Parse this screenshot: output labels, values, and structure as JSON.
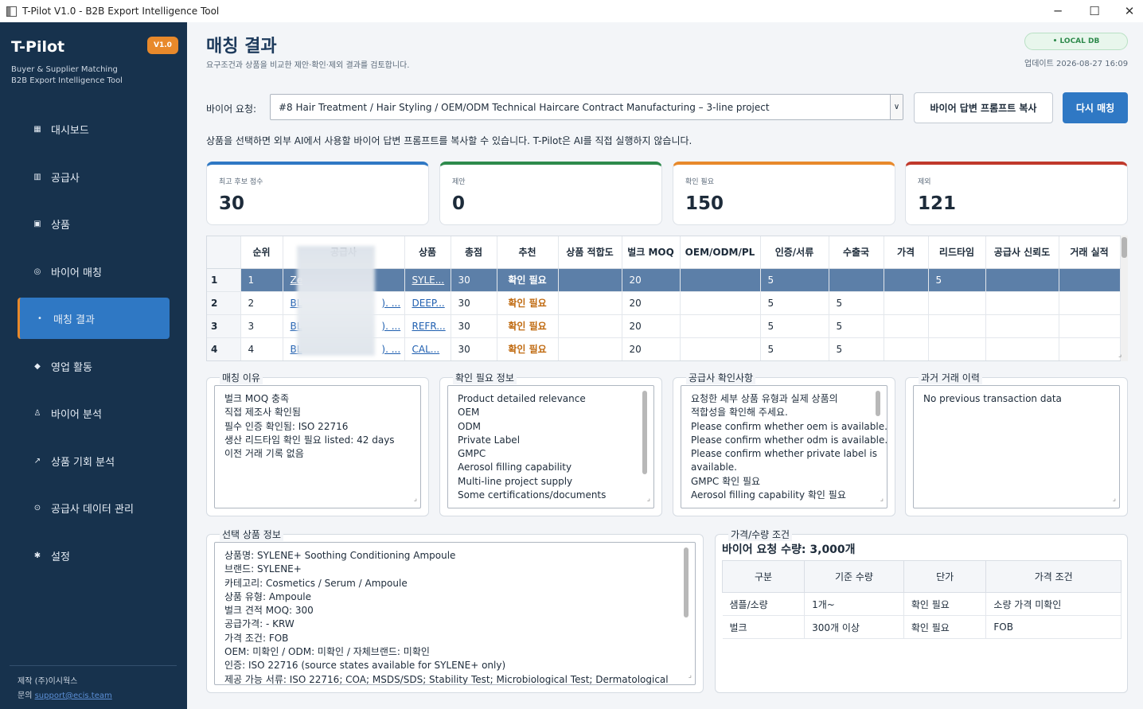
{
  "window": {
    "title": "T-Pilot V1.0 - B2B Export Intelligence Tool"
  },
  "sidebar": {
    "brand": "T-Pilot",
    "version": "V1.0",
    "subtitle1": "Buyer & Supplier Matching",
    "subtitle2": "B2B Export Intelligence Tool",
    "items": [
      {
        "label": "대시보드",
        "icon": "dashboard-icon",
        "glyph": "▦"
      },
      {
        "label": "공급사",
        "icon": "supplier-icon",
        "glyph": "▥"
      },
      {
        "label": "상품",
        "icon": "product-icon",
        "glyph": "▣"
      },
      {
        "label": "바이어 매칭",
        "icon": "target-icon",
        "glyph": "◎"
      },
      {
        "label": "매칭 결과",
        "icon": "dot-icon",
        "glyph": "•"
      },
      {
        "label": "영업 활동",
        "icon": "diamond-icon",
        "glyph": "◆"
      },
      {
        "label": "바이어 분석",
        "icon": "person-icon",
        "glyph": "♙"
      },
      {
        "label": "상품 기회 분석",
        "icon": "trend-icon",
        "glyph": "↗"
      },
      {
        "label": "공급사 데이터 관리",
        "icon": "data-icon",
        "glyph": "⊙"
      },
      {
        "label": "설정",
        "icon": "gear-icon",
        "glyph": "✱"
      }
    ],
    "credit_maker": "제작 (주)이시웍스",
    "credit_contact_label": "문의",
    "credit_contact_link": "support@ecis.team"
  },
  "header": {
    "title": "매칭 결과",
    "subtitle": "요구조건과 상품을 비교한 제안·확인·제외 결과를 검토합니다.",
    "db_badge": "• LOCAL DB",
    "updated": "업데이트  2026-08-27 16:09"
  },
  "buyer": {
    "label": "바이어 요청:",
    "selected": "#8 Hair Treatment / Hair Styling / OEM/ODM Technical Haircare Contract Manufacturing – 3-line project",
    "copy_button": "바이어 답변 프롬프트 복사",
    "rematch_button": "다시 매칭",
    "notice": "상품을 선택하면 외부 AI에서 사용할 바이어 답변 프롬프트를 복사할 수 있습니다. T-Pilot은 AI를 직접 실행하지 않습니다."
  },
  "cards": [
    {
      "label": "최고 후보 점수",
      "value": "30",
      "color": "#2f78c4"
    },
    {
      "label": "제안",
      "value": "0",
      "color": "#2e8a4c"
    },
    {
      "label": "확인 필요",
      "value": "150",
      "color": "#e8892b"
    },
    {
      "label": "제외",
      "value": "121",
      "color": "#c0392b"
    }
  ],
  "table": {
    "columns": [
      "",
      "순위",
      "공급사",
      "상품",
      "총점",
      "추천",
      "상품 적합도",
      "벌크 MOQ",
      "OEM/ODM/PL",
      "인증/서류",
      "수출국",
      "가격",
      "리드타임",
      "공급사 신뢰도",
      "거래 실적"
    ],
    "rows": [
      [
        "1",
        "1",
        "Ze",
        "SYLE...",
        "30",
        "확인 필요",
        "",
        "20",
        "",
        "5",
        "",
        "",
        "5",
        "",
        ""
      ],
      [
        "2",
        "2",
        "BL",
        "DEEP...",
        "30",
        "확인 필요",
        "",
        "20",
        "",
        "5",
        "5",
        "",
        "",
        "",
        ""
      ],
      [
        "3",
        "3",
        "BL",
        "REFR...",
        "30",
        "확인 필요",
        "",
        "20",
        "",
        "5",
        "5",
        "",
        "",
        "",
        ""
      ],
      [
        "4",
        "4",
        "BL",
        "CAL...",
        "30",
        "확인 필요",
        "",
        "20",
        "",
        "5",
        "5",
        "",
        "",
        "",
        ""
      ]
    ],
    "supplier_suffix": "). ..."
  },
  "panels": {
    "reason": {
      "title": "매칭 이유",
      "lines": [
        "벌크 MOQ 충족",
        "직접 제조사 확인됨",
        "필수 인증 확인됨: ISO 22716",
        "생산 리드타임 확인 필요 listed: 42 days",
        "이전 거래 기록 없음"
      ]
    },
    "needs": {
      "title": "확인 필요 정보",
      "lines": [
        "Product detailed relevance",
        "OEM",
        "ODM",
        "Private Label",
        "GMPC",
        "Aerosol filling capability",
        "Multi-line project supply",
        "Some certifications/documents"
      ]
    },
    "supplier_check": {
      "title": "공급사 확인사항",
      "lines": [
        "요청한 세부 상품 유형과 실제 상품의",
        "적합성을 확인해 주세요.",
        "Please confirm whether oem is available.",
        "Please confirm whether odm is available.",
        "Please confirm whether private label is",
        "available.",
        "GMPC 확인 필요",
        "Aerosol filling capability 확인 필요"
      ]
    },
    "history": {
      "title": "과거 거래 이력",
      "lines": [
        "No previous transaction data"
      ]
    },
    "product": {
      "title": "선택 상품 정보",
      "lines": [
        "상품명: SYLENE+ Soothing Conditioning Ampoule",
        "브랜드: SYLENE+",
        "카테고리: Cosmetics / Serum / Ampoule",
        "상품 유형: Ampoule",
        "벌크 견적 MOQ: 300",
        "공급가격: - KRW",
        "가격 조건: FOB",
        "OEM: 미확인 / ODM: 미확인 / 자체브랜드: 미확인",
        "인증: ISO 22716 (source states available for SYLENE+ only)",
        "제공 가능 서류: ISO 22716; COA; MSDS/SDS; Stability Test; Microbiological Test; Dermatological"
      ]
    },
    "price": {
      "title": "가격/수량 조건",
      "quantity": "바이어 요청 수량: 3,000개",
      "columns": [
        "구분",
        "기준 수량",
        "단가",
        "가격 조건"
      ],
      "rows": [
        [
          "샘플/소량",
          "1개~",
          "확인 필요",
          "소량 가격 미확인"
        ],
        [
          "벌크",
          "300개 이상",
          "확인 필요",
          "FOB"
        ]
      ]
    }
  }
}
